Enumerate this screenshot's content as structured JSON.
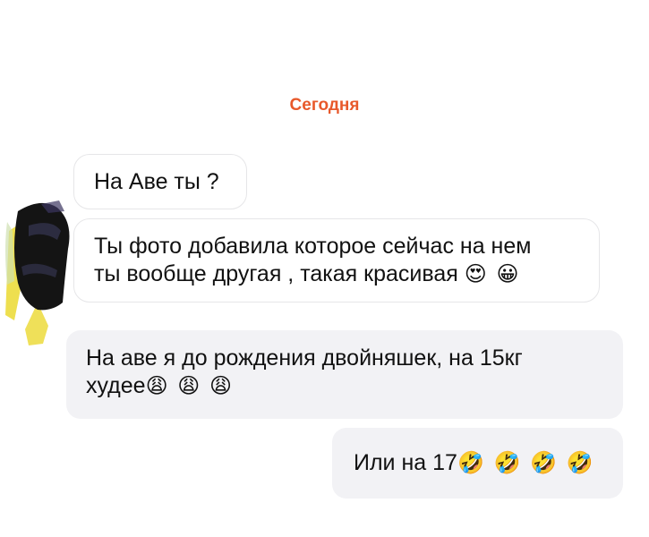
{
  "date_separator": "Сегодня",
  "messages": [
    {
      "direction": "incoming",
      "lines": [
        "На Аве ты ?"
      ]
    },
    {
      "direction": "incoming",
      "lines": [
        "Ты фото добавила которое сейчас на нем",
        "ты вообще другая , такая красивая"
      ],
      "emoji": "😍 😀"
    },
    {
      "direction": "outgoing",
      "lines": [
        "На аве я до рождения двойняшек, на 15кг",
        "худее"
      ],
      "emoji": "😩 😩 😩"
    },
    {
      "direction": "outgoing",
      "lines": [
        "Или на 17"
      ],
      "emoji": "🤣 🤣 🤣 🤣"
    }
  ],
  "colors": {
    "date_accent": "#e8592b",
    "incoming_bg": "#ffffff",
    "incoming_border": "#e6e6e8",
    "outgoing_bg": "#f2f2f5",
    "text": "#111111"
  },
  "avatar": {
    "icon": "redacted-avatar"
  }
}
